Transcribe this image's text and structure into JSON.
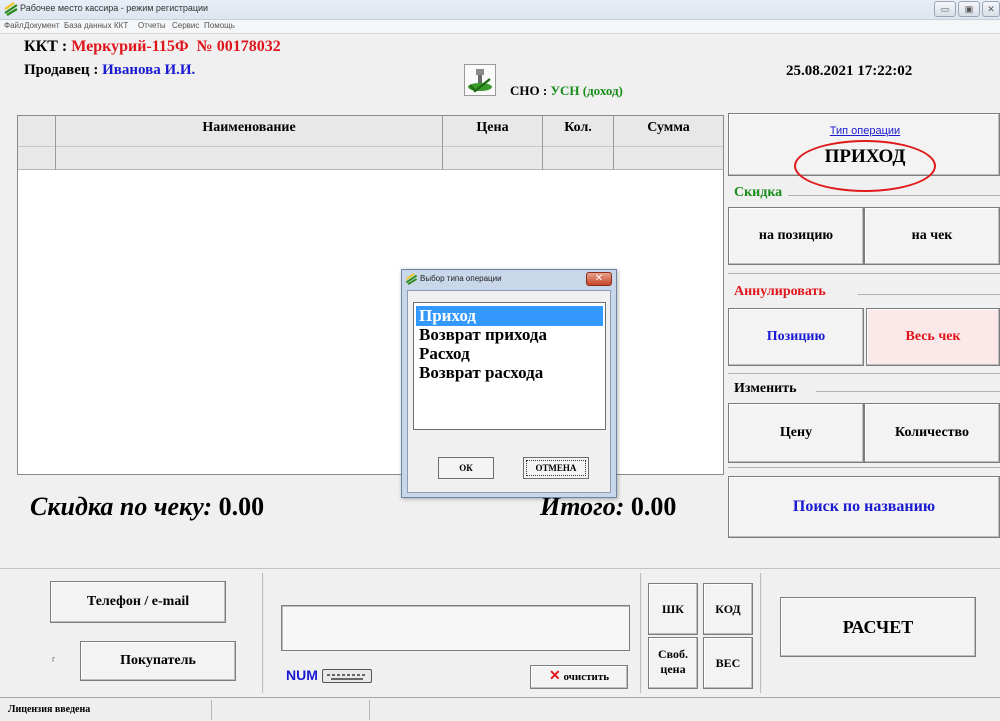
{
  "window": {
    "title": "Рабочее место кассира - режим регистрации",
    "minimize_label": "▭",
    "maximize_label": "▣",
    "close_label": "✕"
  },
  "menu": [
    "Файл",
    "Документ",
    "База данных",
    "ККТ",
    "Отчеты",
    "Сервис",
    "Помощь"
  ],
  "header": {
    "kkt_label": "ККТ : ",
    "kkt_name": "Меркурий-115Ф",
    "kkt_number": "№ 00178032",
    "seller_label": "Продавец : ",
    "seller_name": "Иванова И.И.",
    "sno_label": "СНО : ",
    "sno_value": "УСН (доход)",
    "datetime": "25.08.2021  17:22:02"
  },
  "table": {
    "columns": [
      "Наименование",
      "Цена",
      "Кол.",
      "Сумма"
    ]
  },
  "totals": {
    "discount_label": "Скидка по чеку: ",
    "discount_value": "0.00",
    "total_label": "Итого: ",
    "total_value": "0.00"
  },
  "right_panel": {
    "operation_type_label": "Тип операции",
    "operation_type_value": "ПРИХОД",
    "discount_group": "Скидка",
    "discount_position": "на позицию",
    "discount_receipt": "на чек",
    "cancel_group": "Аннулировать",
    "cancel_position": "Позицию",
    "cancel_receipt": "Весь чек",
    "change_group": "Изменить",
    "change_price": "Цену",
    "change_quantity": "Количество",
    "search_by_name": "Поиск по названию"
  },
  "bottom": {
    "phone_email": "Телефон / e-mail",
    "buyer_checkbox": "г",
    "buyer": "Покупатель",
    "num_label": "NUM",
    "clear_label": "очистить",
    "shk": "ШК",
    "kod": "КОД",
    "free_price_1": "Своб.",
    "free_price_2": "цена",
    "ves": "ВЕС",
    "raschet": "РАСЧЕТ"
  },
  "status_bar": {
    "license": "Лицензия введена"
  },
  "dialog": {
    "title": "Выбор типа операции",
    "options": [
      "Приход",
      "Возврат прихода",
      "Расход",
      "Возврат расхода"
    ],
    "selected_index": 0,
    "ok_label": "ОК",
    "cancel_label": "ОТМЕНА"
  },
  "colors": {
    "red": "#e0151c",
    "blue": "#1a1ad2",
    "green": "#1a8c1a",
    "selection": "#3399ff"
  }
}
